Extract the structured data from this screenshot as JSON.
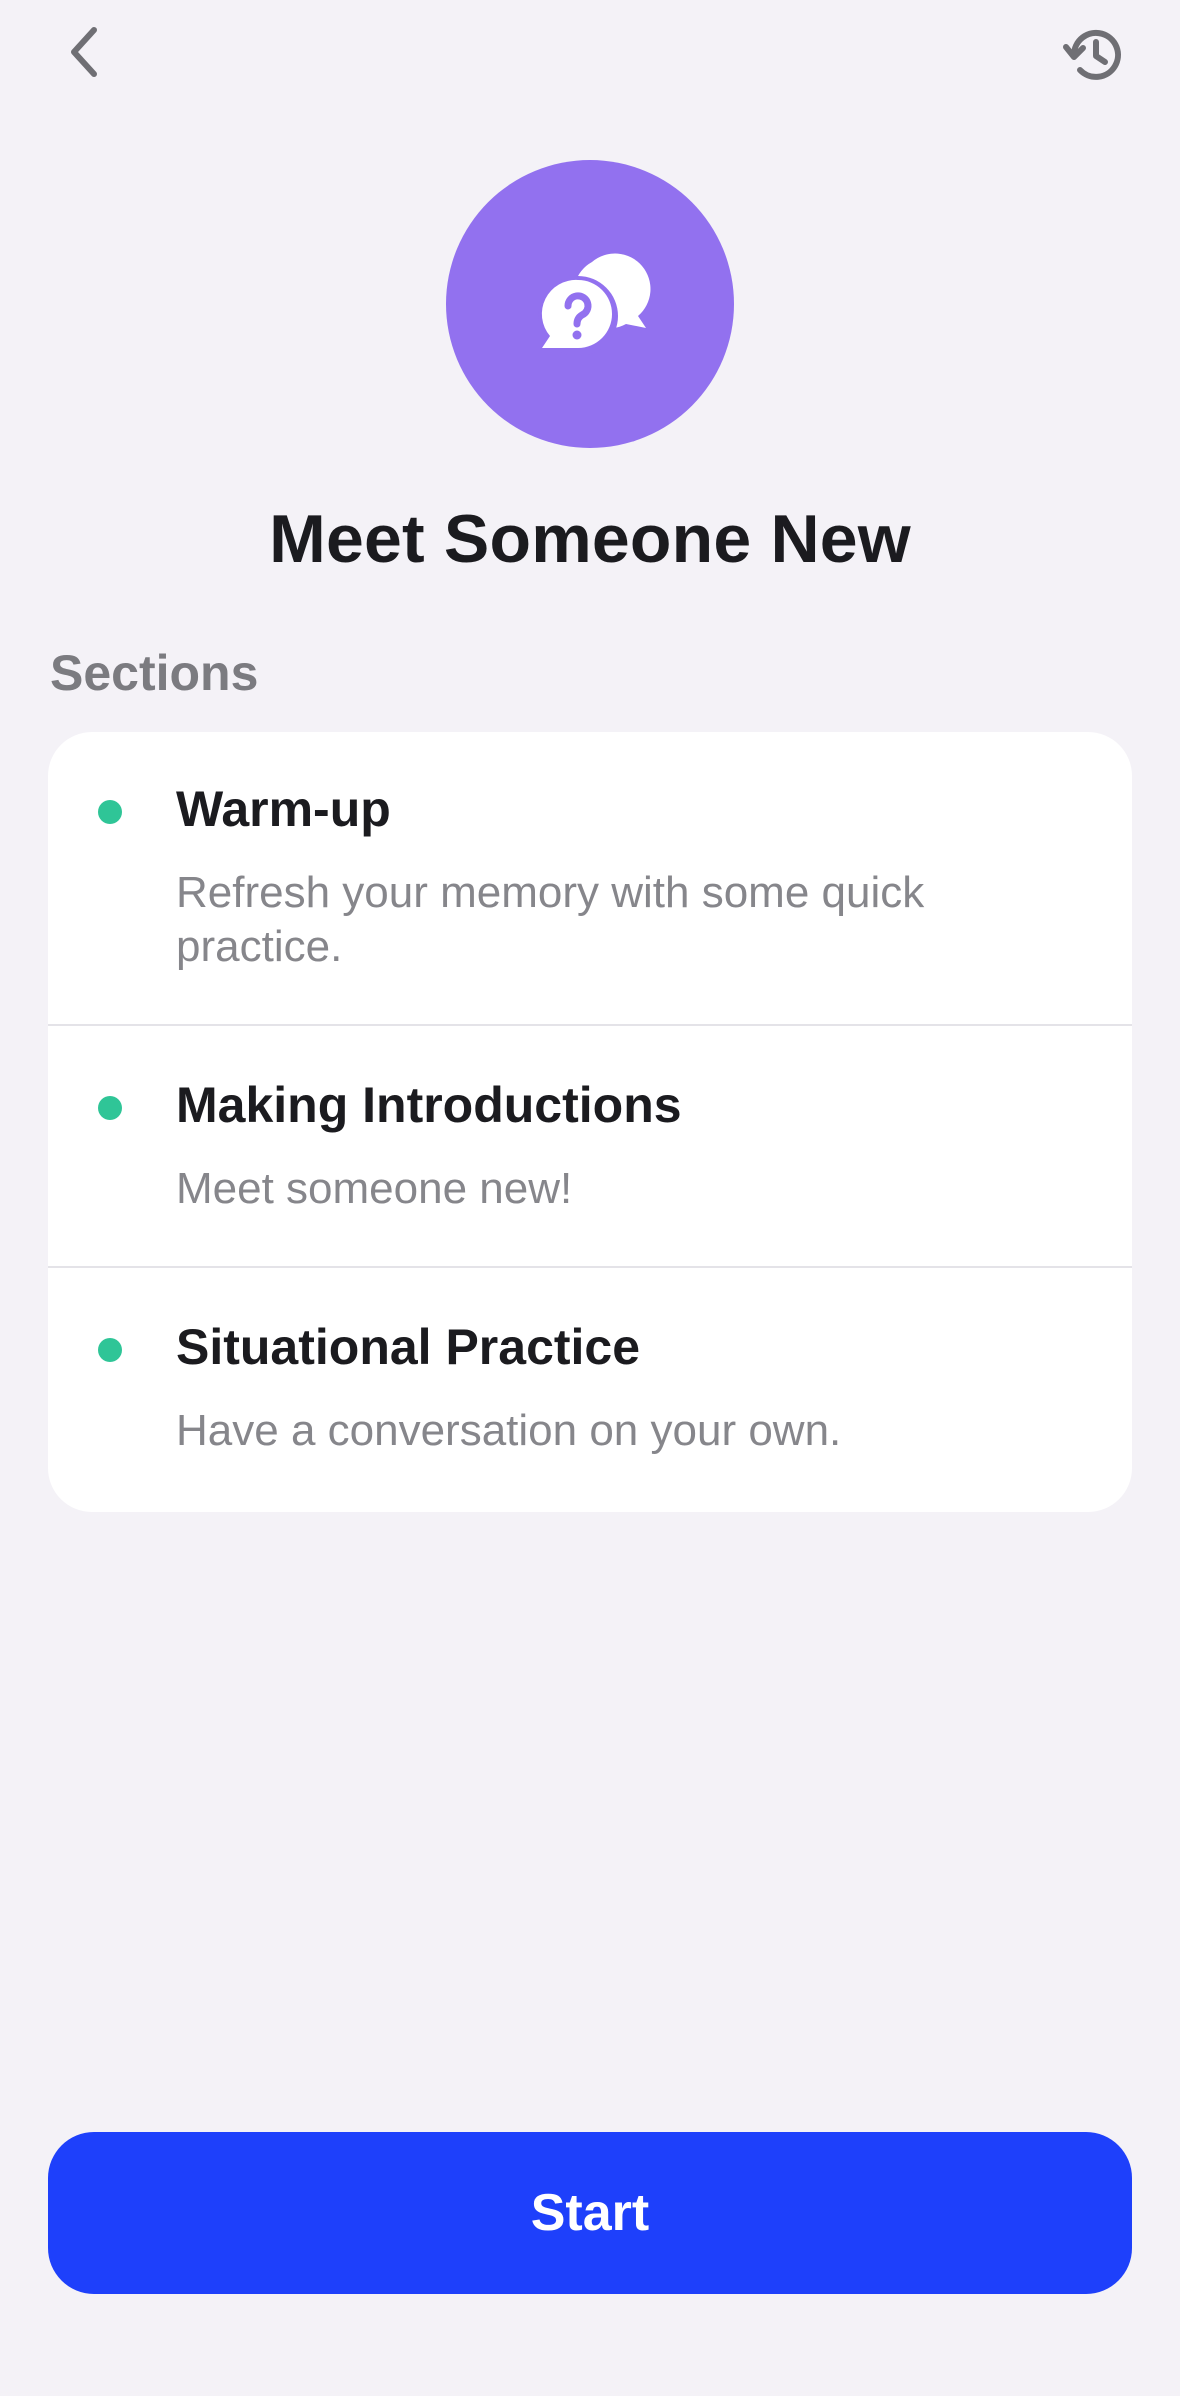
{
  "header": {
    "back_icon": "chevron-left-icon",
    "history_icon": "history-icon"
  },
  "hero": {
    "icon": "chat-question-bubbles-icon",
    "circle_color": "#9271ef",
    "title": "Meet Someone New"
  },
  "sections": {
    "label": "Sections",
    "dot_color": "#2fc597",
    "items": [
      {
        "title": "Warm-up",
        "description": "Refresh your memory with some quick practice."
      },
      {
        "title": "Making Introductions",
        "description": "Meet someone new!"
      },
      {
        "title": "Situational Practice",
        "description": "Have a conversation on your own."
      }
    ]
  },
  "footer": {
    "start_label": "Start",
    "button_color": "#1e40fb"
  }
}
